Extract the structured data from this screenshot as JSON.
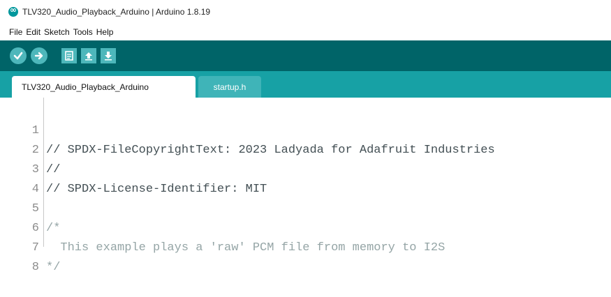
{
  "window": {
    "title": "TLV320_Audio_Playback_Arduino | Arduino 1.8.19"
  },
  "menu": [
    "File",
    "Edit",
    "Sketch",
    "Tools",
    "Help"
  ],
  "toolbar": {
    "buttons": [
      "verify",
      "upload",
      "new",
      "open",
      "save"
    ],
    "colors": {
      "background": "#006468",
      "button": "#4db7bb"
    }
  },
  "tabs": [
    {
      "label": "TLV320_Audio_Playback_Arduino",
      "active": true
    },
    {
      "label": "startup.h",
      "active": false
    }
  ],
  "editor": {
    "lines": [
      {
        "num": "1",
        "text": "// SPDX-FileCopyrightText: 2023 Ladyada for Adafruit Industries"
      },
      {
        "num": "2",
        "text": "//"
      },
      {
        "num": "3",
        "text": "// SPDX-License-Identifier: MIT"
      },
      {
        "num": "4",
        "text": ""
      },
      {
        "num": "5",
        "text": "/*"
      },
      {
        "num": "6",
        "text": "  This example plays a 'raw' PCM file from memory to I2S"
      },
      {
        "num": "7",
        "text": "*/"
      },
      {
        "num": "8",
        "text": ""
      }
    ]
  }
}
